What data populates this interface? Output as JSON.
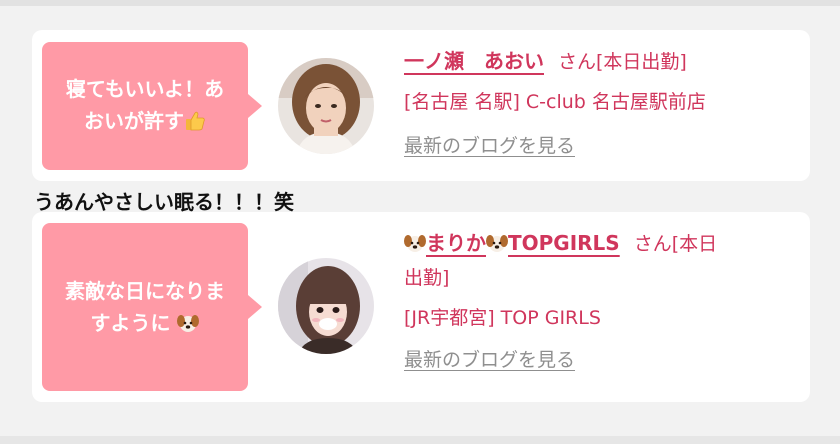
{
  "entries": [
    {
      "message_line1": "寝てもいいよ！あ",
      "message_line2": "おいが許す",
      "message_emoji": "thumbs-up",
      "name": "一ノ瀬　あおい",
      "honorific": "さん[本日出勤]",
      "shop": "[名古屋 名駅] C-club 名古屋駅前店",
      "blog_link": "最新のブログを見る"
    },
    {
      "message_line1": "素敵な日になりま",
      "message_line2": "すように",
      "message_emoji": "dog-face",
      "name_text": "まりか",
      "name_suffix": "TOPGIRLS",
      "honorific": "さん[本日",
      "honorific_line2": "出勤]",
      "shop": "[JR宇都宮] TOP GIRLS",
      "blog_link": "最新のブログを見る"
    }
  ],
  "between_text": "うあんやさしい眠る！！！笑",
  "colors": {
    "accent": "#d0365c",
    "bubble": "#ff9aa6",
    "link_gray": "#8f8f8f"
  }
}
